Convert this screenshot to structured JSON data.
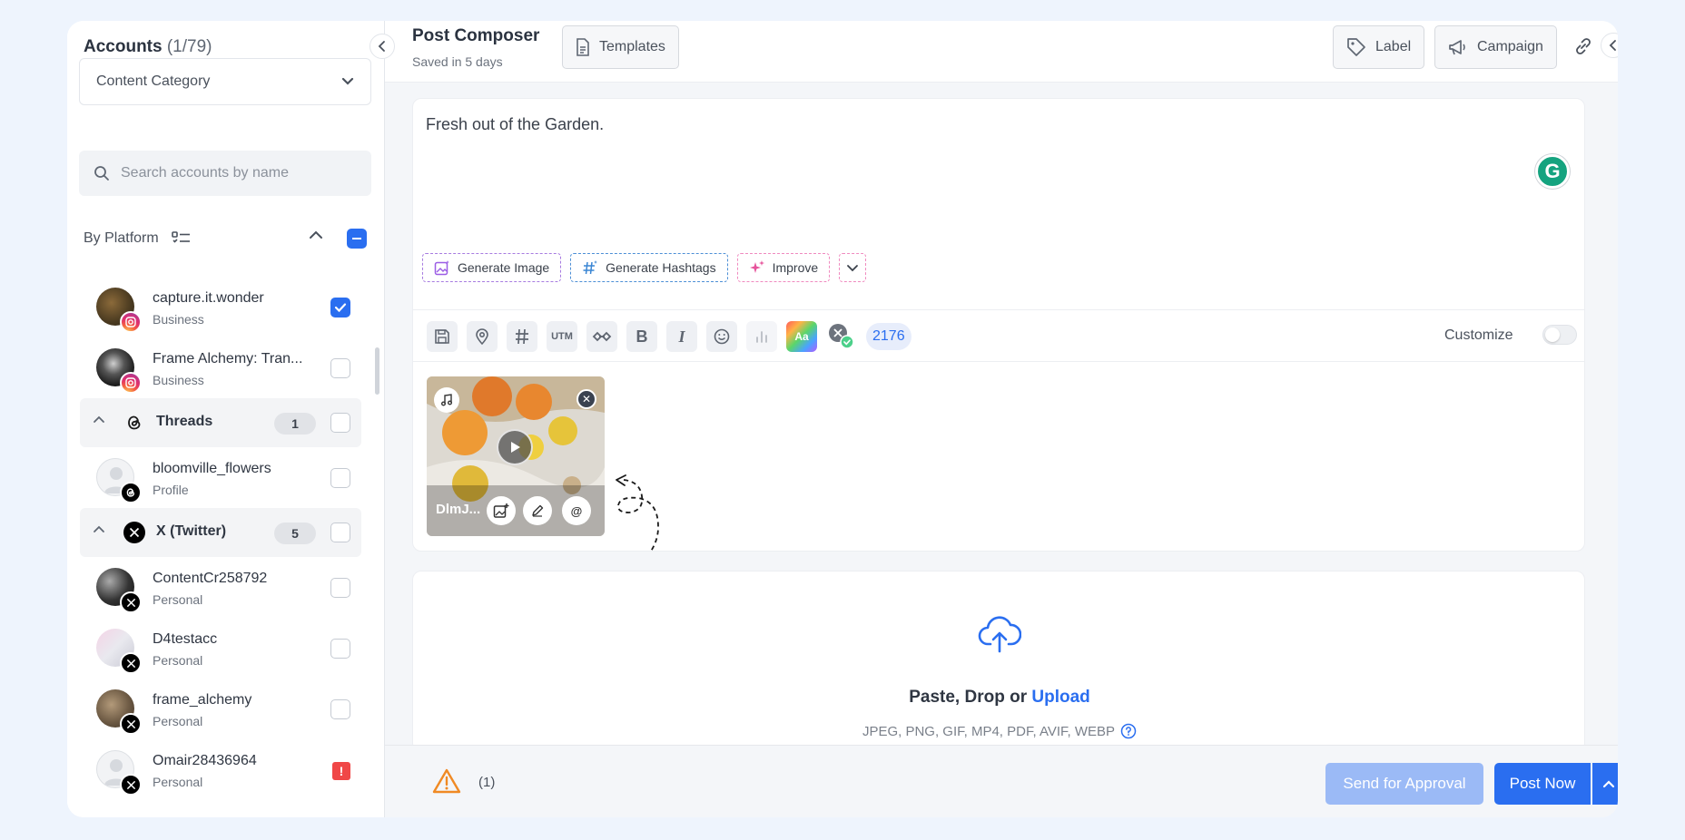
{
  "sidebar": {
    "title": "Accounts",
    "count": "(1/79)",
    "category_select": "Content Category",
    "search_placeholder": "Search accounts by name",
    "by_platform_label": "By Platform",
    "accounts_top": [
      {
        "name": "capture.it.wonder",
        "type": "Business",
        "platform": "instagram",
        "checked": true
      },
      {
        "name": "Frame Alchemy: Tran...",
        "type": "Business",
        "platform": "instagram",
        "checked": false
      }
    ],
    "groups": [
      {
        "name": "Threads",
        "count": "1",
        "icon": "threads-icon",
        "accounts": [
          {
            "name": "bloomville_flowers",
            "type": "Profile",
            "platform": "threads",
            "checked": false
          }
        ]
      },
      {
        "name": "X (Twitter)",
        "count": "5",
        "icon": "x-icon",
        "accounts": [
          {
            "name": "ContentCr258792",
            "type": "Personal",
            "platform": "x",
            "checked": false
          },
          {
            "name": "D4testacc",
            "type": "Personal",
            "platform": "x",
            "checked": false
          },
          {
            "name": "frame_alchemy",
            "type": "Personal",
            "platform": "x",
            "checked": false
          },
          {
            "name": "Omair28436964",
            "type": "Personal",
            "platform": "x",
            "error": true
          }
        ]
      }
    ]
  },
  "header": {
    "title": "Post Composer",
    "saved": "Saved in 5 days",
    "templates": "Templates",
    "label": "Label",
    "campaign": "Campaign"
  },
  "editor": {
    "text": "Fresh out of the Garden.",
    "grammarly": "G",
    "ai": {
      "generate_image": "Generate Image",
      "generate_hashtags": "Generate Hashtags",
      "improve": "Improve"
    },
    "tools": {
      "utm": "UTM",
      "bold": "B",
      "italic": "I",
      "aa": "Aa",
      "char_count": "2176"
    },
    "customize": "Customize",
    "media": {
      "filename": "DlmJ...",
      "mention": "@"
    }
  },
  "upload": {
    "prefix": "Paste, Drop or ",
    "link": "Upload",
    "types": "JPEG, PNG, GIF, MP4, PDF, AVIF, WEBP"
  },
  "footer": {
    "warning_count": "(1)",
    "send_approval": "Send for Approval",
    "post_now": "Post Now"
  },
  "colors": {
    "primary": "#2a6ef0",
    "primary_disabled": "#9bbaf6",
    "warning": "#f08a24",
    "error": "#f04747"
  }
}
